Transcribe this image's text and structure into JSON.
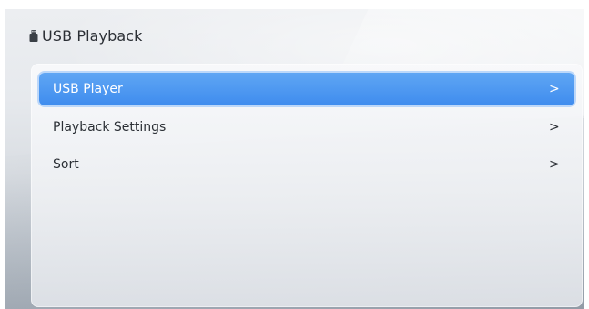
{
  "header": {
    "title": "USB Playback",
    "icon": "usb-drive-icon"
  },
  "menu": {
    "items": [
      {
        "label": "USB Player",
        "chevron": ">",
        "selected": true
      },
      {
        "label": "Playback Settings",
        "chevron": ">",
        "selected": false
      },
      {
        "label": "Sort",
        "chevron": ">",
        "selected": false
      }
    ]
  },
  "colors": {
    "accent": "#4a95f0",
    "text": "#2b2f35"
  }
}
